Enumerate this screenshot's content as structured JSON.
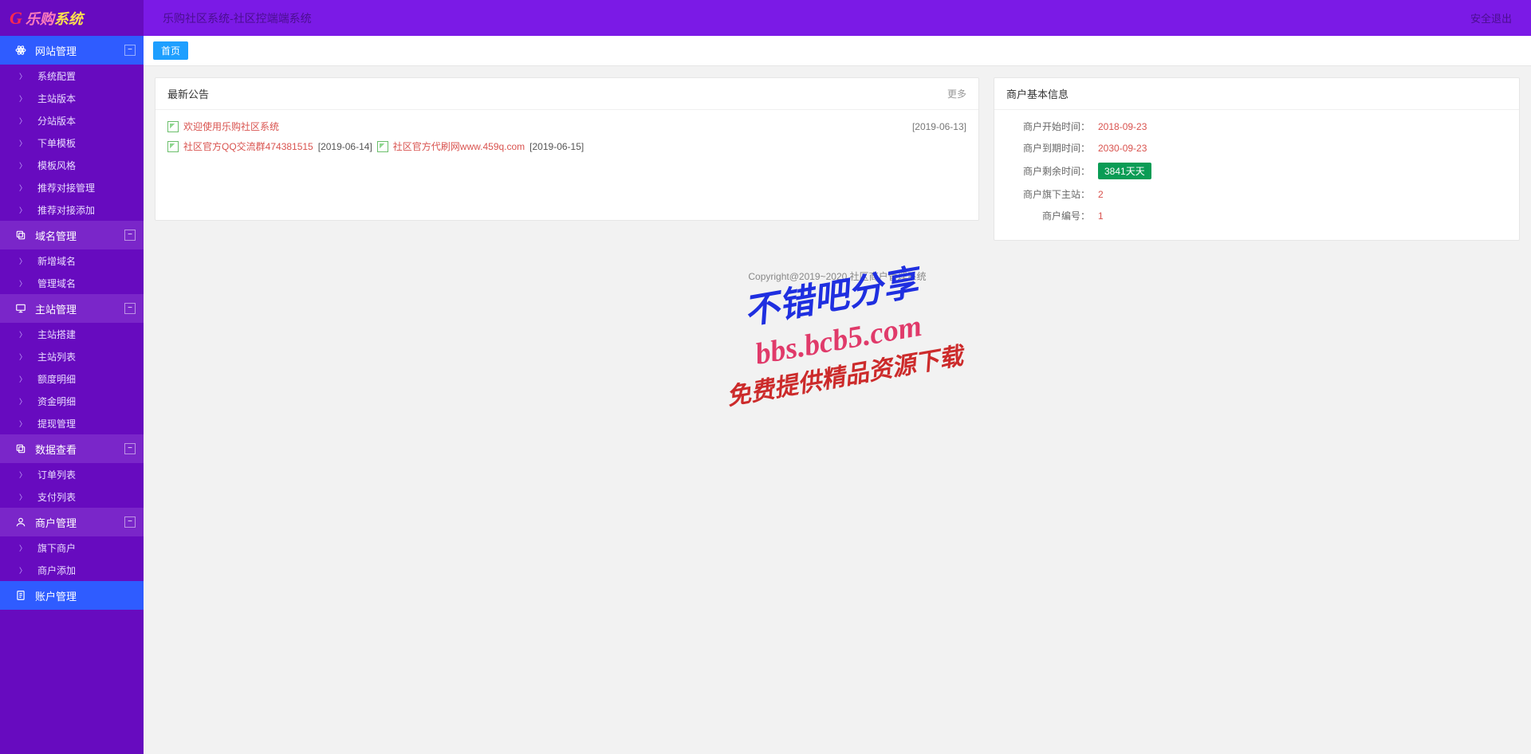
{
  "brand": {
    "mark": "G",
    "text_a": "乐购",
    "text_b": "系统"
  },
  "topbar": {
    "title": "乐购社区系统-社区控端端系统",
    "logout": "安全退出"
  },
  "breadcrumb": {
    "home": "首页"
  },
  "sidebar": [
    {
      "label": "网站管理",
      "active": true,
      "icon": "atom",
      "items": [
        "系统配置",
        "主站版本",
        "分站版本",
        "下单模板",
        "模板风格",
        "推荐对接管理",
        "推荐对接添加"
      ]
    },
    {
      "label": "域名管理",
      "icon": "copy",
      "items": [
        "新增域名",
        "管理域名"
      ]
    },
    {
      "label": "主站管理",
      "icon": "monitor",
      "items": [
        "主站搭建",
        "主站列表",
        "额度明细",
        "资金明细",
        "提现管理"
      ]
    },
    {
      "label": "数据查看",
      "icon": "copy",
      "items": [
        "订单列表",
        "支付列表"
      ]
    },
    {
      "label": "商户管理",
      "icon": "user",
      "items": [
        "旗下商户",
        "商户添加"
      ]
    },
    {
      "label": "账户管理",
      "icon": "doc",
      "alt": true,
      "items": []
    }
  ],
  "announce": {
    "title": "最新公告",
    "more": "更多",
    "row1": {
      "text": "欢迎使用乐购社区系统",
      "date": "[2019-06-13]"
    },
    "row2": [
      {
        "text": "社区官方QQ交流群474381515",
        "date": "[2019-06-14]"
      },
      {
        "text": "社区官方代刷网www.459q.com",
        "date": "[2019-06-15]"
      }
    ]
  },
  "merchant": {
    "title": "商户基本信息",
    "rows": {
      "start": {
        "k": "商户开始时间：",
        "v": "2018-09-23"
      },
      "end": {
        "k": "商户到期时间：",
        "v": "2030-09-23"
      },
      "remain": {
        "k": "商户剩余时间：",
        "v": "3841天天"
      },
      "sites": {
        "k": "商户旗下主站：",
        "v": "2"
      },
      "id": {
        "k": "商户编号：",
        "v": "1"
      }
    }
  },
  "footer": "Copyright@2019~2020 社区商户管理系统",
  "watermark": {
    "l1": "不错吧分享",
    "l2": "bbs.bcb5.com",
    "l3": "免费提供精品资源下载"
  }
}
